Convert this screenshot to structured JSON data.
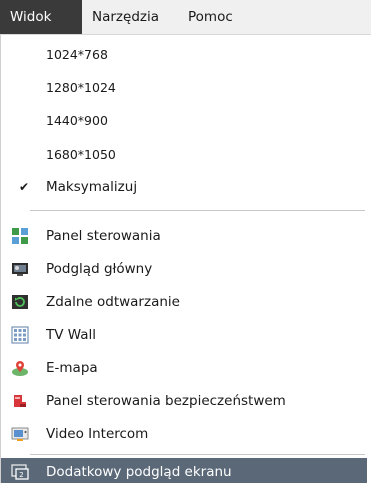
{
  "menubar": {
    "items": [
      "Widok",
      "Narzędzia",
      "Pomoc"
    ],
    "active_index": 0
  },
  "menu": {
    "resolutions": [
      "1024*768",
      "1280*1024",
      "1440*900",
      "1680*1050"
    ],
    "maximize": {
      "label": "Maksymalizuj",
      "checked": true,
      "check_glyph": "✔"
    },
    "views": [
      {
        "label": "Panel sterowania",
        "icon": "control-panel-icon"
      },
      {
        "label": "Podgląd główny",
        "icon": "main-view-icon"
      },
      {
        "label": "Zdalne odtwarzanie",
        "icon": "remote-playback-icon"
      },
      {
        "label": "TV Wall",
        "icon": "tv-wall-icon"
      },
      {
        "label": "E-mapa",
        "icon": "e-map-icon"
      },
      {
        "label": "Panel sterowania bezpieczeństwem",
        "icon": "security-panel-icon"
      },
      {
        "label": "Video Intercom",
        "icon": "video-intercom-icon"
      }
    ],
    "extra": {
      "label": "Dodatkowy podgląd ekranu",
      "icon": "extra-screen-view-icon",
      "highlighted": true
    }
  },
  "colors": {
    "menubar_active_bg": "#3a3a3a",
    "highlight_bg": "#5a6878"
  }
}
